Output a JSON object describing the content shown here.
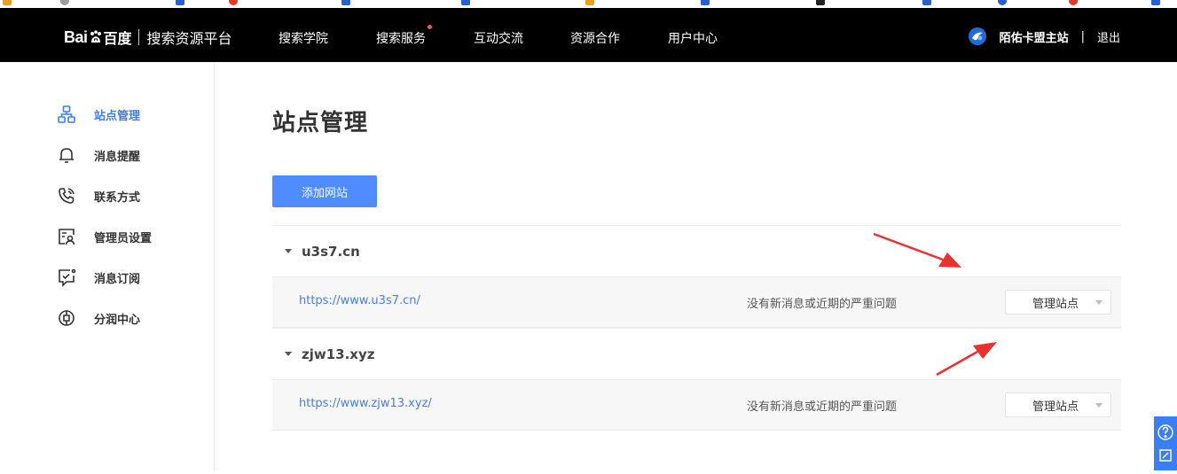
{
  "header": {
    "logo_bai": "Bai",
    "logo_cn": "百度",
    "platform": "搜索资源平台",
    "nav": [
      {
        "label": "搜索学院"
      },
      {
        "label": "搜索服务",
        "has_dot": true
      },
      {
        "label": "互动交流"
      },
      {
        "label": "资源合作"
      },
      {
        "label": "用户中心"
      }
    ],
    "username": "陌佑卡盟主站",
    "divider": "|",
    "logout": "退出"
  },
  "sidebar": {
    "items": [
      {
        "label": "站点管理",
        "icon": "sitemap-icon",
        "active": true
      },
      {
        "label": "消息提醒",
        "icon": "bell-icon"
      },
      {
        "label": "联系方式",
        "icon": "phone-icon"
      },
      {
        "label": "管理员设置",
        "icon": "admin-icon"
      },
      {
        "label": "消息订阅",
        "icon": "subscribe-icon"
      },
      {
        "label": "分润中心",
        "icon": "share-icon"
      }
    ]
  },
  "main": {
    "title": "站点管理",
    "add_button": "添加网站",
    "groups": [
      {
        "domain": "u3s7.cn",
        "sites": [
          {
            "url": "https://www.u3s7.cn/",
            "status": "没有新消息或近期的严重问题",
            "manage_label": "管理站点"
          }
        ]
      },
      {
        "domain": "zjw13.xyz",
        "sites": [
          {
            "url": "https://www.zjw13.xyz/",
            "status": "没有新消息或近期的严重问题",
            "manage_label": "管理站点"
          }
        ]
      }
    ]
  },
  "colors": {
    "accent": "#3a7ef6",
    "button": "#4e8cff",
    "topbar": "#000000",
    "annotation": "#e8322f"
  }
}
